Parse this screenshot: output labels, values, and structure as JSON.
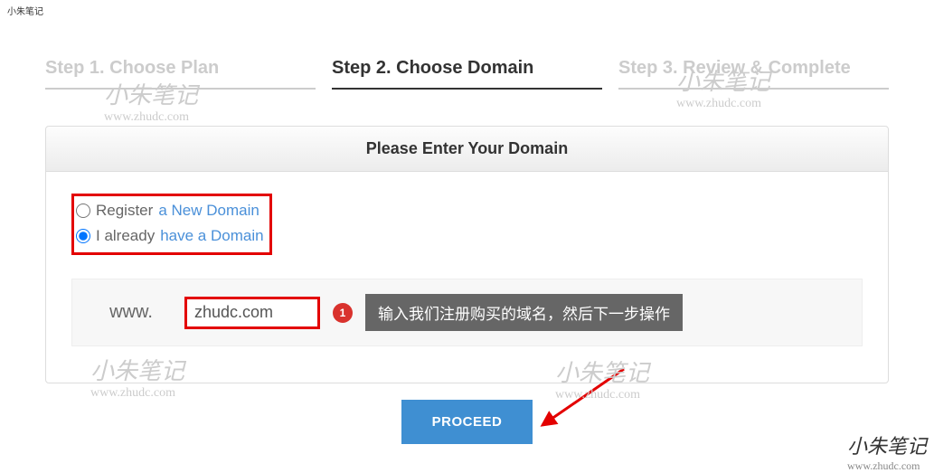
{
  "watermark": {
    "title": "小朱笔记",
    "url": "www.zhudc.com"
  },
  "steps": [
    {
      "label": "Step 1. Choose Plan"
    },
    {
      "label": "Step 2. Choose Domain"
    },
    {
      "label": "Step 3. Review & Complete"
    }
  ],
  "card": {
    "header": "Please Enter Your Domain",
    "radios": [
      {
        "text_before": "Register ",
        "text_link": "a New Domain",
        "value": "register"
      },
      {
        "text_before": "I already ",
        "text_link": "have a Domain",
        "value": "have"
      }
    ],
    "selected_radio": "have",
    "domain": {
      "prefix": "www.",
      "value": "zhudc.com"
    },
    "annotation": {
      "num": "1",
      "text": "输入我们注册购买的域名，然后下一步操作"
    }
  },
  "proceed_label": "PROCEED"
}
